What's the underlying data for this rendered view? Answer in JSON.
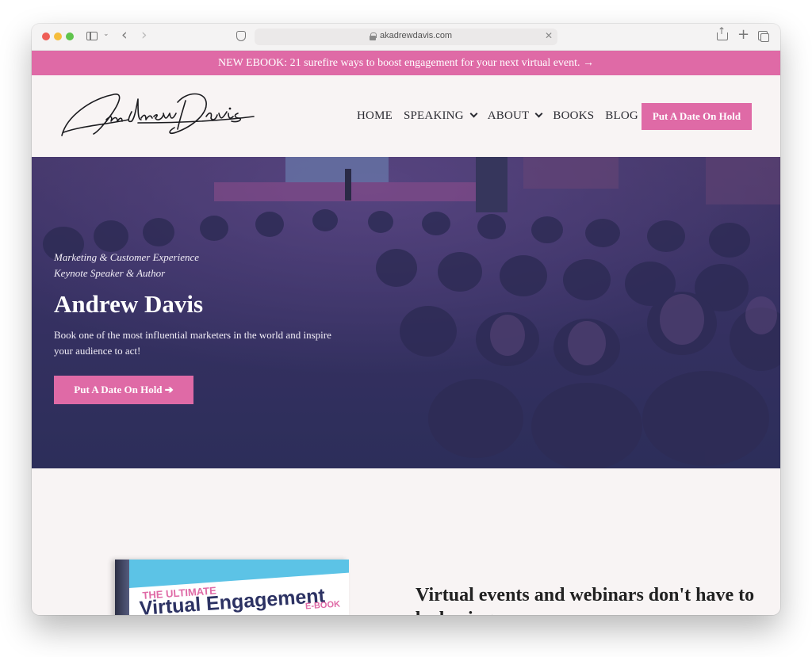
{
  "browser": {
    "url": "akadrewdavis.com"
  },
  "announcement": {
    "text": "NEW EBOOK: 21 surefire ways to boost engagement for your next virtual event. →"
  },
  "header": {
    "logo_text": "Andrew Davis",
    "nav": [
      {
        "label": "HOME",
        "dropdown": false
      },
      {
        "label": "SPEAKING",
        "dropdown": true
      },
      {
        "label": "ABOUT",
        "dropdown": true
      },
      {
        "label": "BOOKS",
        "dropdown": false
      },
      {
        "label": "BLOG",
        "dropdown": false
      }
    ],
    "cta_label": "Put A Date On Hold"
  },
  "hero": {
    "subtitle_line1": "Marketing & Customer Experience",
    "subtitle_line2": "Keynote Speaker & Author",
    "title": "Andrew Davis",
    "description": "Book one of the most influential marketers in the world and inspire your audience to act!",
    "cta_label": "Put A Date On Hold ➔"
  },
  "lower": {
    "ebook_pre": "THE ULTIMATE",
    "ebook_title": "Virtual Engagement",
    "ebook_tag": "E-BOOK",
    "heading": "Virtual events and webinars don't have to be boring."
  },
  "colors": {
    "brand_pink": "#df6aa6",
    "hero_overlay": "#2b2d58",
    "page_bg": "#f8f4f4"
  }
}
